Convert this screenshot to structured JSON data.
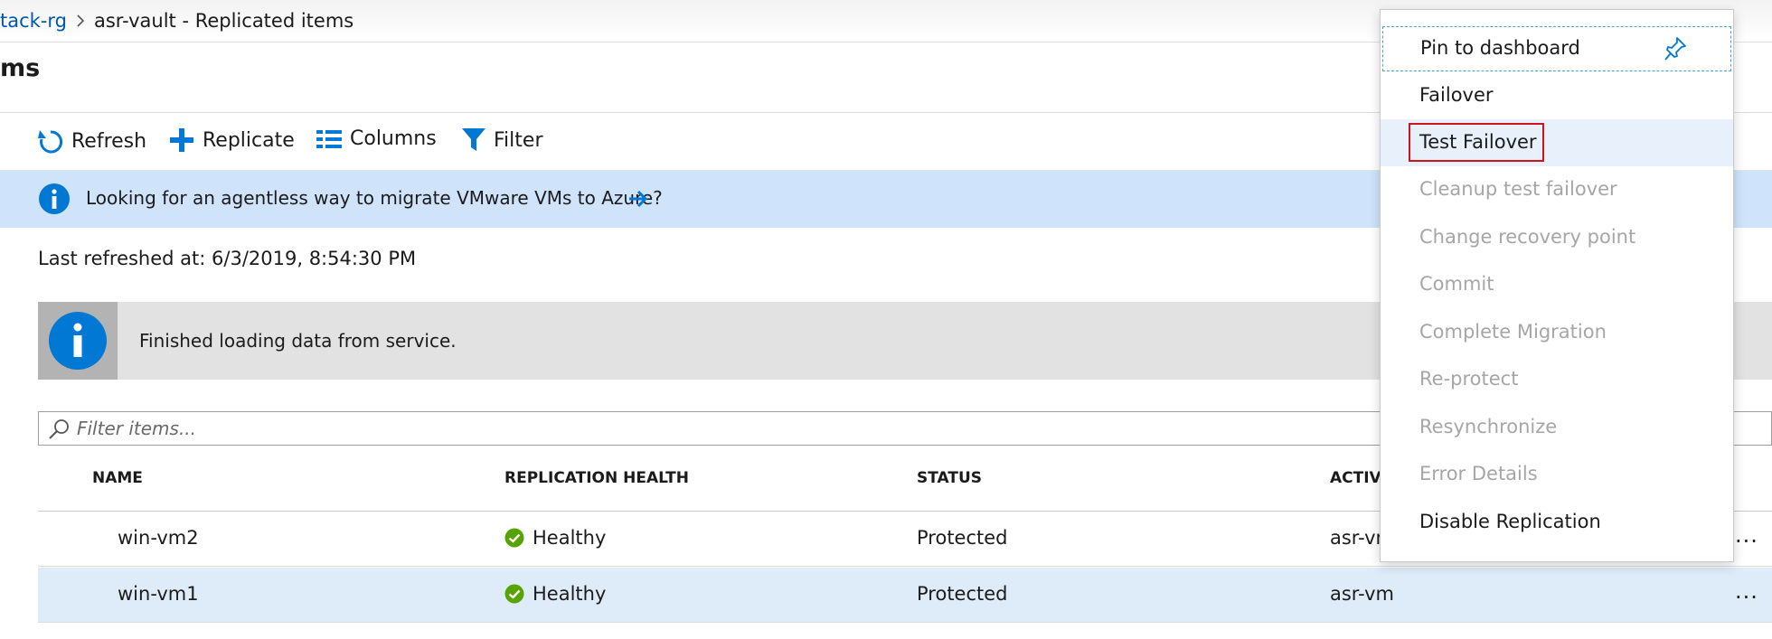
{
  "breadcrumb": {
    "parent": "tack-rg",
    "separator": ">",
    "current": "asr-vault - Replicated items"
  },
  "page": {
    "title": "ms"
  },
  "toolbar": {
    "refresh": "Refresh",
    "replicate": "Replicate",
    "columns": "Columns",
    "filter": "Filter"
  },
  "promo": {
    "text": "Looking for an agentless way to migrate VMware VMs to Azure?"
  },
  "status": {
    "last_refreshed": "Last refreshed at: 6/3/2019, 8:54:30 PM"
  },
  "notice": {
    "text": "Finished loading data from service."
  },
  "search": {
    "placeholder": "Filter items..."
  },
  "table": {
    "headers": [
      "NAME",
      "REPLICATION HEALTH",
      "STATUS",
      "ACTIVI"
    ],
    "rows": [
      {
        "name": "win-vm2",
        "health": "Healthy",
        "status": "Protected",
        "active": "asr-vr",
        "more": "..."
      },
      {
        "name": "win-vm1",
        "health": "Healthy",
        "status": "Protected",
        "active": "asr-vm",
        "more": "..."
      }
    ]
  },
  "context_menu": {
    "items": [
      {
        "label": "Pin to dashboard",
        "enabled": true
      },
      {
        "label": "Failover",
        "enabled": true
      },
      {
        "label": "Test Failover",
        "enabled": true
      },
      {
        "label": "Cleanup test failover",
        "enabled": false
      },
      {
        "label": "Change recovery point",
        "enabled": false
      },
      {
        "label": "Commit",
        "enabled": false
      },
      {
        "label": "Complete Migration",
        "enabled": false
      },
      {
        "label": "Re-protect",
        "enabled": false
      },
      {
        "label": "Resynchronize",
        "enabled": false
      },
      {
        "label": "Error Details",
        "enabled": false
      },
      {
        "label": "Disable Replication",
        "enabled": true
      }
    ]
  },
  "colors": {
    "accent": "#0078d4",
    "link": "#0058ad",
    "healthy": "#57a300",
    "highlight": "#d0141b",
    "promo_bg": "#cfe3fb",
    "selected_row": "#deecf9"
  },
  "icons": [
    "chevron-right-icon",
    "refresh-icon",
    "plus-icon",
    "columns-icon",
    "filter-icon",
    "info-icon",
    "arrow-right-icon",
    "search-icon",
    "check-circle-icon",
    "pin-icon",
    "more-icon"
  ]
}
